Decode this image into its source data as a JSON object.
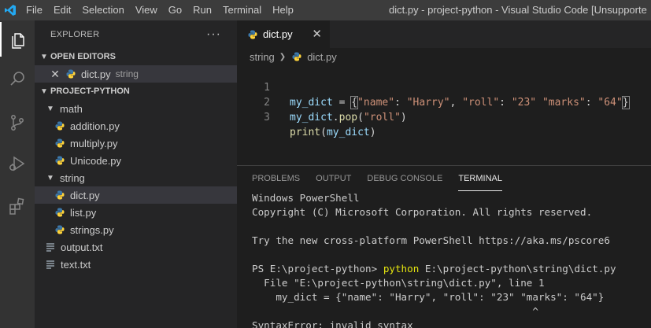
{
  "titlebar": {
    "menu": [
      "File",
      "Edit",
      "Selection",
      "View",
      "Go",
      "Run",
      "Terminal",
      "Help"
    ],
    "window_title": "dict.py - project-python - Visual Studio Code [Unsupporte"
  },
  "activity_bar": {
    "icons": [
      "files-icon",
      "search-icon",
      "source-control-icon",
      "run-debug-icon",
      "extensions-icon"
    ]
  },
  "sidebar": {
    "title": "EXPLORER",
    "more": "···",
    "open_editors": {
      "header": "OPEN EDITORS",
      "items": [
        {
          "name": "dict.py",
          "desc": "string"
        }
      ]
    },
    "project": {
      "header": "PROJECT-PYTHON",
      "folders": [
        {
          "name": "math",
          "files": [
            "addition.py",
            "multiply.py",
            "Unicode.py"
          ]
        },
        {
          "name": "string",
          "files": [
            "dict.py",
            "list.py",
            "strings.py"
          ]
        }
      ],
      "files": [
        "output.txt",
        "text.txt"
      ]
    }
  },
  "editor": {
    "tab_label": "dict.py",
    "tab_close": "✕",
    "breadcrumb": [
      "string",
      "dict.py"
    ],
    "line_numbers": [
      "1",
      "2",
      "3"
    ],
    "lines": [
      {
        "var": "my_dict",
        "assign": " = ",
        "open": "{",
        "k1": "\"name\"",
        "c1": ": ",
        "v1": "\"Harry\"",
        "sep1": ", ",
        "k2": "\"roll\"",
        "c2": ": ",
        "v2": "\"23\"",
        "sp": " ",
        "k3": "\"marks\"",
        "c3": ": ",
        "v3": "\"64\"",
        "close": "}"
      },
      {
        "var": "my_dict",
        "dot": ".",
        "fn": "pop",
        "open": "(",
        "arg": "\"roll\"",
        "close": ")"
      },
      {
        "fn": "print",
        "open": "(",
        "arg": "my_dict",
        "close": ")"
      }
    ]
  },
  "panel": {
    "tabs": [
      "PROBLEMS",
      "OUTPUT",
      "DEBUG CONSOLE",
      "TERMINAL"
    ],
    "active_tab": "TERMINAL",
    "terminal": {
      "l1": "Windows PowerShell",
      "l2": "Copyright (C) Microsoft Corporation. All rights reserved.",
      "l3": "",
      "l4": "Try the new cross-platform PowerShell https://aka.ms/pscore6",
      "l5": "",
      "prompt": "PS E:\\project-python> ",
      "cmd": "python",
      "cmd_arg": " E:\\project-python\\string\\dict.py",
      "l7": "  File \"E:\\project-python\\string\\dict.py\", line 1",
      "l8": "    my_dict = {\"name\": \"Harry\", \"roll\": \"23\" \"marks\": \"64\"}",
      "l9": "                                               ^",
      "l10": "SyntaxError: invalid syntax"
    }
  },
  "colors": {
    "accent_python": "#3c78aa",
    "python_yellow": "#ffd43b",
    "terminal_cmd": "#e5e510"
  }
}
